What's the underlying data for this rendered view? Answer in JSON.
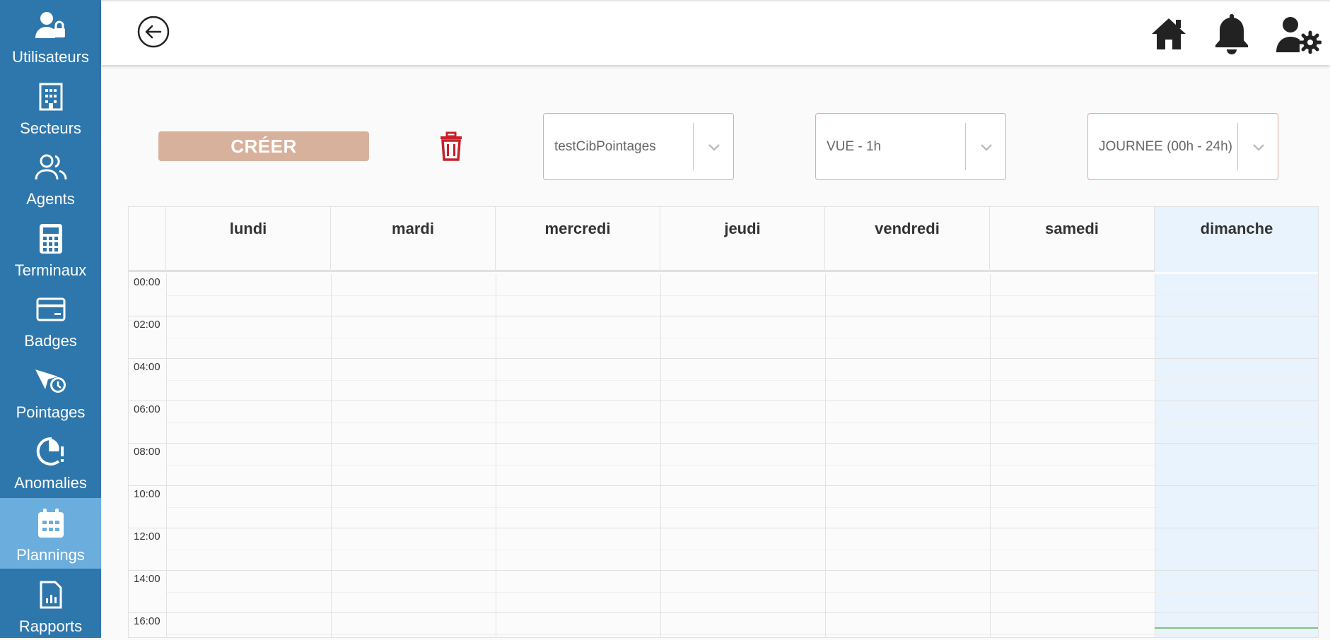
{
  "sidebar": {
    "items": [
      {
        "label": "Utilisateurs",
        "icon": "users-lock-icon"
      },
      {
        "label": "Secteurs",
        "icon": "building-icon"
      },
      {
        "label": "Agents",
        "icon": "users-icon"
      },
      {
        "label": "Terminaux",
        "icon": "calculator-icon"
      },
      {
        "label": "Badges",
        "icon": "card-icon"
      },
      {
        "label": "Pointages",
        "icon": "clock-plane-icon"
      },
      {
        "label": "Anomalies",
        "icon": "anomaly-icon"
      },
      {
        "label": "Plannings",
        "icon": "calendar-icon"
      },
      {
        "label": "Rapports",
        "icon": "report-icon"
      }
    ],
    "active": "Plannings",
    "color": "#2e77ad",
    "active_color": "#6baedd"
  },
  "toolbar": {
    "create_label": "CRÉER",
    "create_color": "#d8b19c",
    "delete_color": "#c8202a"
  },
  "selects": {
    "planning": "testCibPointages",
    "view": "VUE - 1h",
    "range": "JOURNEE (00h - 24h)"
  },
  "calendar": {
    "days": [
      "lundi",
      "mardi",
      "mercredi",
      "jeudi",
      "vendredi",
      "samedi",
      "dimanche"
    ],
    "today": "dimanche",
    "times": [
      "00:00",
      "02:00",
      "04:00",
      "06:00",
      "08:00",
      "10:00",
      "12:00",
      "14:00",
      "16:00"
    ]
  }
}
